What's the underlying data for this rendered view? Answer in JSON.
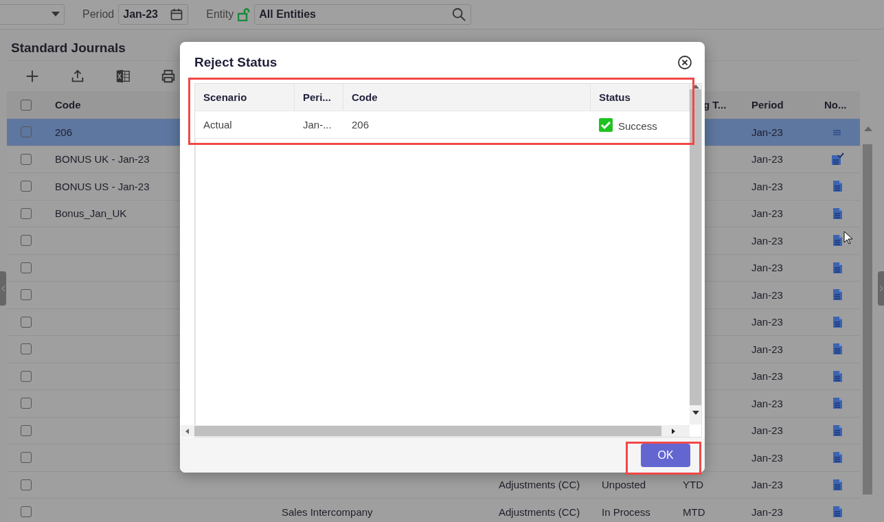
{
  "filters": {
    "period_label": "Period",
    "period_value": "Jan-23",
    "entity_label": "Entity",
    "entity_locked": false,
    "entity_value": "All Entities"
  },
  "page_title": "Standard Journals",
  "toolbar": [
    {
      "kind": "add"
    },
    {
      "kind": "upload"
    },
    {
      "kind": "excel"
    },
    {
      "kind": "print"
    }
  ],
  "table": {
    "select_all_checked": false,
    "columns": [
      "Code",
      "g T...",
      "Period",
      "No..."
    ],
    "rows": [
      {
        "selected": true,
        "checked": false,
        "code": "206",
        "period": "Jan-23",
        "note": {
          "kind": "lines"
        }
      },
      {
        "selected": false,
        "checked": false,
        "code": "BONUS UK - Jan-23",
        "period": "Jan-23",
        "note": {
          "kind": "approved"
        }
      },
      {
        "selected": false,
        "checked": false,
        "code": "BONUS US - Jan-23",
        "period": "Jan-23",
        "note": {
          "kind": "doc"
        }
      },
      {
        "selected": false,
        "checked": false,
        "code": "Bonus_Jan_UK",
        "period": "Jan-23",
        "note": {
          "kind": "doc"
        }
      },
      {
        "selected": false,
        "checked": false,
        "period": "Jan-23",
        "note": {
          "kind": "doc"
        }
      },
      {
        "selected": false,
        "checked": false,
        "period": "Jan-23",
        "note": {
          "kind": "doc"
        }
      },
      {
        "selected": false,
        "checked": false,
        "period": "Jan-23",
        "note": {
          "kind": "doc"
        }
      },
      {
        "selected": false,
        "checked": false,
        "period": "Jan-23",
        "note": {
          "kind": "doc"
        }
      },
      {
        "selected": false,
        "checked": false,
        "period": "Jan-23",
        "note": {
          "kind": "doc"
        }
      },
      {
        "selected": false,
        "checked": false,
        "period": "Jan-23",
        "note": {
          "kind": "doc"
        }
      },
      {
        "selected": false,
        "checked": false,
        "period": "Jan-23",
        "note": {
          "kind": "doc"
        }
      },
      {
        "selected": false,
        "checked": false,
        "period": "Jan-23",
        "note": {
          "kind": "doc"
        }
      },
      {
        "selected": false,
        "checked": false,
        "period": "Jan-23",
        "note": {
          "kind": "doc"
        }
      },
      {
        "selected": false,
        "checked": false,
        "type": "Adjustments (CC)",
        "status": "Unposted",
        "mode": "YTD",
        "period": "Jan-23",
        "note": {
          "kind": "doc"
        }
      },
      {
        "selected": false,
        "checked": false,
        "description": "Sales Intercompany",
        "type": "Adjustments (CC)",
        "status": "In Process",
        "mode": "MTD",
        "period": "Jan-23",
        "note": {
          "kind": "doc"
        }
      }
    ]
  },
  "dialog": {
    "title": "Reject Status",
    "columns": [
      "Scenario",
      "Peri...",
      "Code",
      "Status"
    ],
    "rows": [
      {
        "scenario": "Actual",
        "period": "Jan-...",
        "code": "206",
        "status": "Success",
        "success": true
      }
    ],
    "button": "OK"
  }
}
